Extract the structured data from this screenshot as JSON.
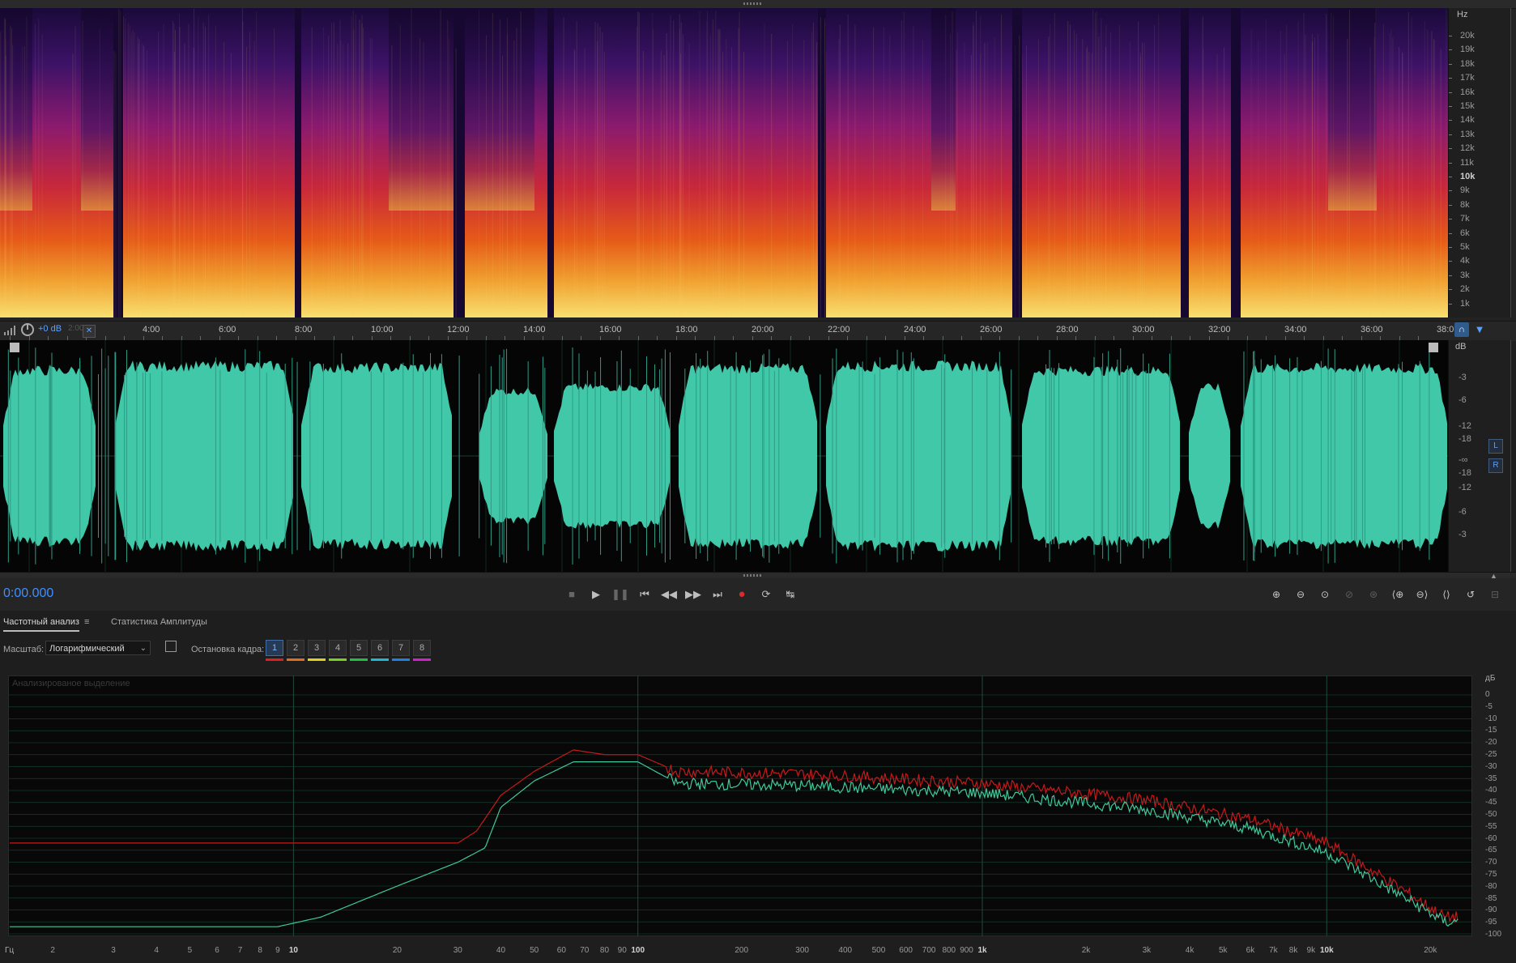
{
  "spectral": {
    "unit": "Hz",
    "hz_labels": [
      "20k",
      "19k",
      "18k",
      "17k",
      "16k",
      "15k",
      "14k",
      "13k",
      "12k",
      "11k",
      "10k",
      "9k",
      "8k",
      "7k",
      "6k",
      "5k",
      "4k",
      "3k",
      "2k",
      "1k"
    ],
    "highlight_label": "10k"
  },
  "timeline": {
    "labels": [
      "4:00",
      "6:00",
      "8:00",
      "10:00",
      "12:00",
      "14:00",
      "16:00",
      "18:00",
      "20:00",
      "22:00",
      "24:00",
      "26:00",
      "28:00",
      "30:00",
      "32:00",
      "34:00",
      "36:00",
      "38:0"
    ],
    "gain": "+0 dB",
    "gain_ghost": "2:00"
  },
  "waveform": {
    "unit": "dB",
    "db_labels_top": [
      "-3",
      "-6",
      "-12",
      "-18",
      "-∞"
    ],
    "db_labels_bottom": [
      "-18",
      "-12",
      "-6",
      "-3"
    ],
    "channel_left": "L",
    "channel_right": "R",
    "wave_color": "#40c8a8"
  },
  "transport": {
    "time": "0:00.000",
    "buttons": [
      "stop",
      "play",
      "pause",
      "skip-to-start",
      "rewind",
      "fast-forward",
      "skip-to-end",
      "record",
      "loop",
      "skip-selection"
    ]
  },
  "analysis": {
    "tabs": {
      "freq": "Частотный анализ",
      "menu": "≡",
      "amp": "Статистика Амплитуды"
    },
    "scale_label": "Масштаб:",
    "scale_value": "Логарифмический",
    "freeze_label": "Остановка кадра:",
    "frames": [
      "1",
      "2",
      "3",
      "4",
      "5",
      "6",
      "7",
      "8"
    ],
    "frame_colors": [
      "#e02020",
      "#e06d20",
      "#e0d020",
      "#7ad020",
      "#20c040",
      "#20b8d0",
      "#2080e0",
      "#d020d0"
    ],
    "caption": "Анализированое выделение",
    "db_unit": "дБ",
    "db_labels": [
      "0",
      "-5",
      "-10",
      "-15",
      "-20",
      "-25",
      "-30",
      "-35",
      "-40",
      "-45",
      "-50",
      "-55",
      "-60",
      "-65",
      "-70",
      "-75",
      "-80",
      "-85",
      "-90",
      "-95",
      "-100"
    ],
    "hz_unit": "Гц",
    "hz_labels": [
      "2",
      "3",
      "4",
      "5",
      "6",
      "7",
      "8",
      "9",
      "10",
      "20",
      "30",
      "40",
      "50",
      "60",
      "70",
      "80",
      "90",
      "100",
      "200",
      "300",
      "400",
      "500",
      "600",
      "700",
      "800",
      "900",
      "1k",
      "2k",
      "3k",
      "4k",
      "5k",
      "6k",
      "7k",
      "8k",
      "9k",
      "10k",
      "20k"
    ],
    "hz_bold": [
      "10",
      "100",
      "1k",
      "10k"
    ],
    "curve_colors": {
      "red": "#c41a1a",
      "green": "#40c89a"
    }
  }
}
